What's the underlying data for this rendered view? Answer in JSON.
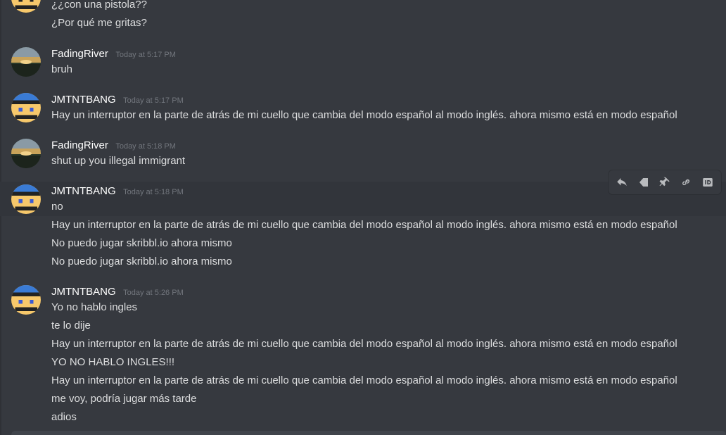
{
  "top_fragment": {
    "lines": [
      "¿¿con una pistola??",
      "¿Por qué me gritas?"
    ]
  },
  "messages": [
    {
      "author": "FadingRiver",
      "time": "Today at 5:17 PM",
      "avatar": "sunset-avatar",
      "lines": [
        "bruh"
      ]
    },
    {
      "author": "JMTNTBANG",
      "time": "Today at 5:17 PM",
      "avatar": "pixel-face-avatar",
      "lines": [
        "Hay un interruptor en la parte de atrás de mi cuello que cambia del modo español al modo inglés. ahora mismo está en modo español"
      ]
    },
    {
      "author": "FadingRiver",
      "time": "Today at 5:18 PM",
      "avatar": "sunset-avatar",
      "lines": [
        "shut up you illegal immigrant"
      ]
    },
    {
      "author": "JMTNTBANG",
      "time": "Today at 5:18 PM",
      "avatar": "pixel-face-avatar",
      "lines": [
        "no",
        "Hay un interruptor en la parte de atrás de mi cuello que cambia del modo español al modo inglés. ahora mismo está en modo español",
        "No puedo jugar skribbl.io ahora mismo",
        "No puedo jugar skribbl.io ahora mismo"
      ]
    },
    {
      "author": "JMTNTBANG",
      "time": "Today at 5:26 PM",
      "avatar": "pixel-face-avatar",
      "lines": [
        "Yo no hablo ingles",
        "te lo dije",
        "Hay un interruptor en la parte de atrás de mi cuello que cambia del modo español al modo inglés. ahora mismo está en modo español",
        "YO NO HABLO INGLES!!!",
        "Hay un interruptor en la parte de atrás de mi cuello que cambia del modo español al modo inglés. ahora mismo está en modo español",
        "me voy, podría jugar más tarde",
        "adios"
      ]
    }
  ],
  "toolbar": {
    "buttons": [
      "reply-icon",
      "bookmark-icon",
      "pin-icon",
      "link-icon",
      "id-icon"
    ]
  },
  "colors": {
    "background": "#36393f",
    "username": "#ffffff",
    "timestamp": "#72767d",
    "text": "#dcddde",
    "hover": "#32353b"
  }
}
